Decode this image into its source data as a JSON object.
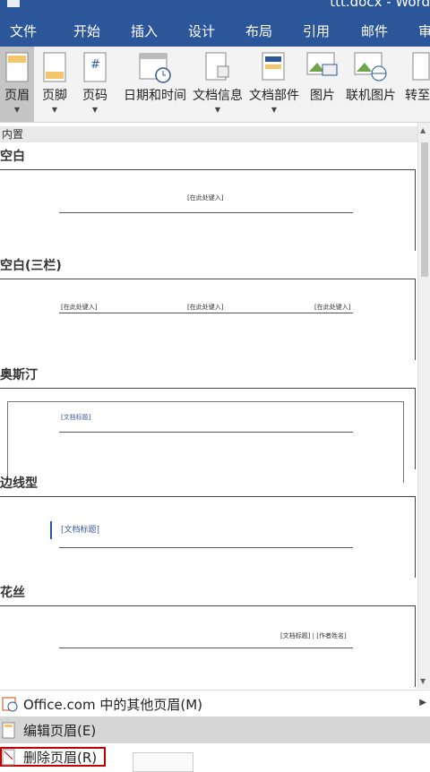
{
  "window": {
    "title": "ttt.docx - Word"
  },
  "menu": {
    "tabs": [
      "文件",
      "开始",
      "插入",
      "设计",
      "布局",
      "引用",
      "邮件",
      "审"
    ]
  },
  "ribbon": {
    "buttons": [
      {
        "label": "页眉",
        "icon": "header-page-icon"
      },
      {
        "label": "页脚",
        "icon": "footer-page-icon"
      },
      {
        "label": "页码",
        "icon": "page-number-icon"
      },
      {
        "label": "日期和时间",
        "icon": "calendar-clock-icon"
      },
      {
        "label": "文档信息",
        "icon": "document-info-icon"
      },
      {
        "label": "文档部件",
        "icon": "quick-parts-icon"
      },
      {
        "label": "图片",
        "icon": "picture-icon"
      },
      {
        "label": "联机图片",
        "icon": "online-picture-icon"
      },
      {
        "label": "转至",
        "icon": "goto-icon"
      }
    ]
  },
  "gallery": {
    "section": "内置",
    "items": [
      {
        "name": "空白",
        "placeholders": [
          "[在此处键入]"
        ]
      },
      {
        "name": "空白(三栏)",
        "placeholders": [
          "[在此处键入]",
          "[在此处键入]",
          "[在此处键入]"
        ]
      },
      {
        "name": "奥斯汀",
        "placeholders": [
          "[文档标题]"
        ]
      },
      {
        "name": "边线型",
        "placeholders": [
          "[文档标题]"
        ]
      },
      {
        "name": "花丝",
        "placeholders": [
          "[文档标题] | [作者姓名]"
        ]
      }
    ]
  },
  "dropdown_menu": {
    "items": [
      {
        "label": "Office.com 中的其他页眉(M)",
        "icon": "office-com-icon",
        "has_submenu": true
      },
      {
        "label": "编辑页眉(E)",
        "icon": "edit-header-icon",
        "highlighted": true
      },
      {
        "label": "删除页眉(R)",
        "icon": "delete-header-icon"
      }
    ]
  }
}
